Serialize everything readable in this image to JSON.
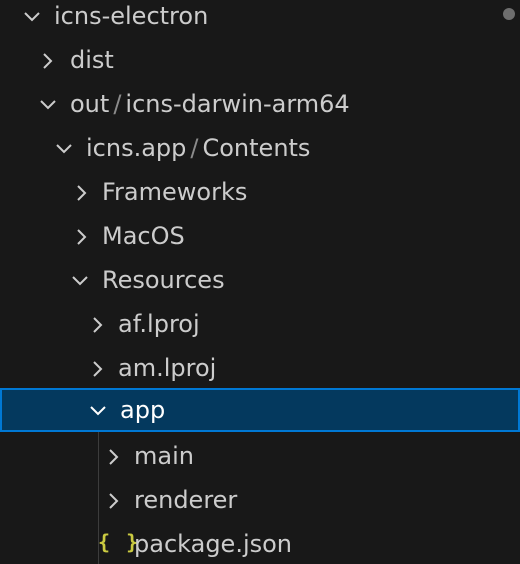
{
  "explorer": {
    "root": {
      "label": "icns-electron",
      "expanded": true,
      "icon": "chevron-down-icon"
    },
    "items": [
      {
        "label": "dist",
        "expanded": false,
        "icon": "chevron-right-icon"
      },
      {
        "label": "out",
        "compact_suffix": "icns-darwin-arm64",
        "expanded": true,
        "icon": "chevron-down-icon"
      },
      {
        "label": "icns.app",
        "compact_suffix": "Contents",
        "expanded": true,
        "icon": "chevron-down-icon"
      },
      {
        "label": "Frameworks",
        "expanded": false,
        "icon": "chevron-right-icon"
      },
      {
        "label": "MacOS",
        "expanded": false,
        "icon": "chevron-right-icon"
      },
      {
        "label": "Resources",
        "expanded": true,
        "icon": "chevron-down-icon"
      },
      {
        "label": "af.lproj",
        "expanded": false,
        "icon": "chevron-right-icon"
      },
      {
        "label": "am.lproj",
        "expanded": false,
        "icon": "chevron-right-icon"
      },
      {
        "label": "app",
        "expanded": true,
        "selected": true,
        "icon": "chevron-down-icon"
      },
      {
        "label": "main",
        "expanded": false,
        "icon": "chevron-right-icon"
      },
      {
        "label": "renderer",
        "expanded": false,
        "icon": "chevron-right-icon"
      },
      {
        "label": "package.json",
        "icon": "json-braces-icon",
        "icon_text": "{ }"
      }
    ],
    "path_separator": "/"
  },
  "colors": {
    "background": "#181818",
    "selected_background": "#04395e",
    "selected_border": "#0078d4",
    "json_icon": "#cbcb41",
    "modified_dot": "#6e6e6e"
  }
}
